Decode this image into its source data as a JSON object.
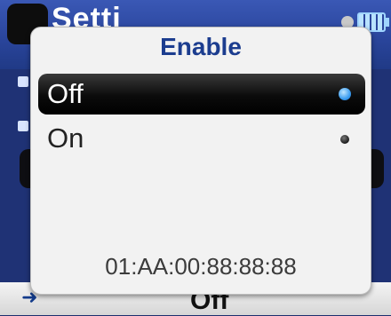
{
  "background": {
    "title": "Setti",
    "footer_value": "Off",
    "footer_arrow": "➜"
  },
  "dialog": {
    "title": "Enable",
    "options": [
      {
        "label": "Off",
        "selected": true
      },
      {
        "label": "On",
        "selected": false
      }
    ],
    "mac_address": "01:AA:00:88:88:88"
  },
  "colors": {
    "header_blue": "#2a459c",
    "title_blue": "#1c3d8f",
    "selected_dot": "#3b9df0"
  }
}
